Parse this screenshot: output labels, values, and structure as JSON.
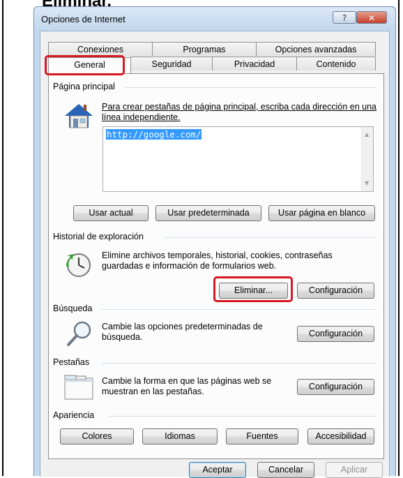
{
  "caption": "Eliminar.",
  "window": {
    "title": "Opciones de Internet",
    "help_label": "?",
    "close_label": "✕"
  },
  "tabs_row1": [
    "Conexiones",
    "Programas",
    "Opciones avanzadas"
  ],
  "tabs_row2": [
    "General",
    "Seguridad",
    "Privacidad",
    "Contenido"
  ],
  "homepage": {
    "label": "Página principal",
    "description": "Para crear pestañas de página principal, escriba cada dirección en una línea independiente.",
    "url": "http://google.com/",
    "buttons": [
      "Usar actual",
      "Usar predeterminada",
      "Usar página en blanco"
    ]
  },
  "history": {
    "label": "Historial de exploración",
    "description": "Elimine archivos temporales, historial, cookies, contraseñas guardadas e información de formularios web.",
    "delete_label": "Eliminar...",
    "settings_label": "Configuración"
  },
  "search": {
    "label": "Búsqueda",
    "description": "Cambie las opciones predeterminadas de búsqueda.",
    "settings_label": "Configuración"
  },
  "tabs_section": {
    "label": "Pestañas",
    "description": "Cambie la forma en que las páginas web se muestran en las pestañas.",
    "settings_label": "Configuración"
  },
  "appearance": {
    "label": "Apariencia",
    "buttons": [
      "Colores",
      "Idiomas",
      "Fuentes",
      "Accesibilidad"
    ]
  },
  "footer": {
    "ok_label": "Aceptar",
    "cancel_label": "Cancelar",
    "apply_label": "Aplicar"
  },
  "colors": {
    "highlight": "#d81720",
    "selection": "#3399ff",
    "window_frame": "#c3d9ef"
  },
  "icons": [
    "house-icon",
    "history-clock-icon",
    "magnifier-icon",
    "tabs-window-icon"
  ]
}
